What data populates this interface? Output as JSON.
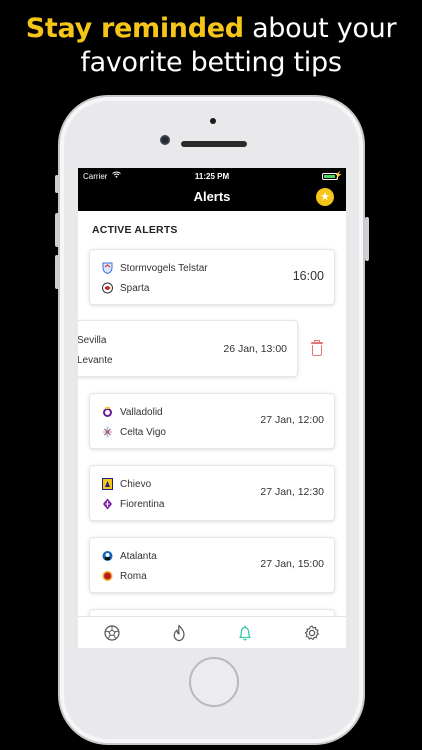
{
  "headline": {
    "highlight": "Stay reminded",
    "line1_rest": " about your",
    "line2": "favorite betting tips"
  },
  "status_bar": {
    "carrier": "Carrier",
    "time": "11:25 PM"
  },
  "nav": {
    "title": "Alerts",
    "favorites_icon": "star-icon"
  },
  "section_title": "ACTIVE ALERTS",
  "alerts": [
    {
      "home": "Stormvogels Telstar",
      "away": "Sparta",
      "kickoff": "16:00"
    },
    {
      "home": "Sevilla",
      "away": "Levante",
      "kickoff": "26 Jan, 13:00"
    },
    {
      "home": "Valladolid",
      "away": "Celta Vigo",
      "kickoff": "27 Jan, 12:00"
    },
    {
      "home": "Chievo",
      "away": "Fiorentina",
      "kickoff": "27 Jan, 12:30"
    },
    {
      "home": "Atalanta",
      "away": "Roma",
      "kickoff": "27 Jan, 15:00"
    }
  ],
  "delete_icon": "trash-icon",
  "tabs": [
    {
      "icon": "soccer-ball-icon"
    },
    {
      "icon": "flame-icon"
    },
    {
      "icon": "bell-icon",
      "active": true
    },
    {
      "icon": "gear-icon"
    }
  ],
  "colors": {
    "accent_yellow": "#f5c518",
    "active_tab": "#37c8a5",
    "delete_red": "#e57373"
  }
}
